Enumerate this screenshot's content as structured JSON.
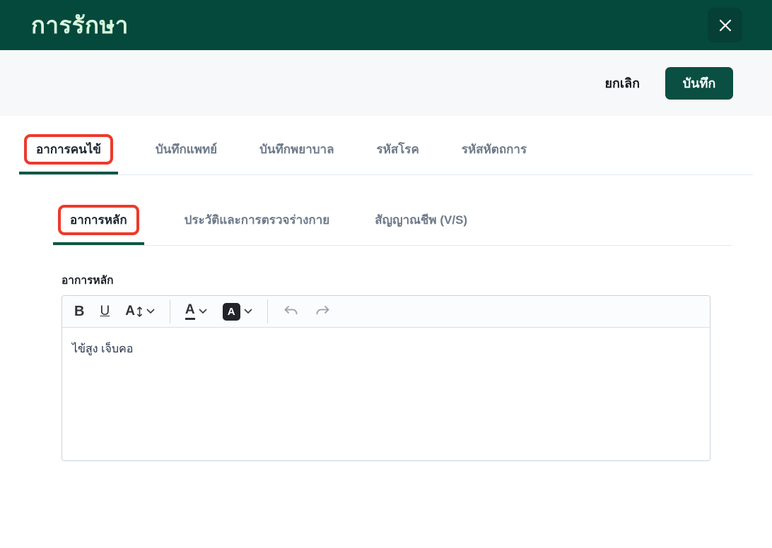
{
  "dialog": {
    "title": "การรักษา"
  },
  "actions": {
    "cancel_label": "ยกเลิก",
    "save_label": "บันทึก"
  },
  "tabs": {
    "items": [
      {
        "label": "อาการคนไข้",
        "active": true,
        "annotated": true
      },
      {
        "label": "บันทึกแพทย์",
        "active": false
      },
      {
        "label": "บันทึกพยาบาล",
        "active": false
      },
      {
        "label": "รหัสโรค",
        "active": false
      },
      {
        "label": "รหัสหัตถการ",
        "active": false
      }
    ]
  },
  "subtabs": {
    "items": [
      {
        "label": "อาการหลัก",
        "active": true,
        "annotated": true
      },
      {
        "label": "ประวัติและการตรวจร่างกาย",
        "active": false
      },
      {
        "label": "สัญญาณชีพ (V/S)",
        "active": false
      }
    ]
  },
  "editor": {
    "label": "อาการหลัก",
    "content": "ไข้สูง เจ็บคอ",
    "toolbar": {
      "bold_label": "B",
      "underline_label": "U",
      "font_size_label": "A",
      "text_color_label": "A",
      "highlight_label": "A"
    }
  },
  "colors": {
    "header_bg": "#04493C",
    "accent_green": "#0B4F43",
    "active_underline": "#0E5745",
    "annotation_red": "#EE392B",
    "title_text": "#D8F7DC",
    "inactive_tab_text": "#6E7A8A",
    "action_bar_bg": "#F7F8FA"
  }
}
